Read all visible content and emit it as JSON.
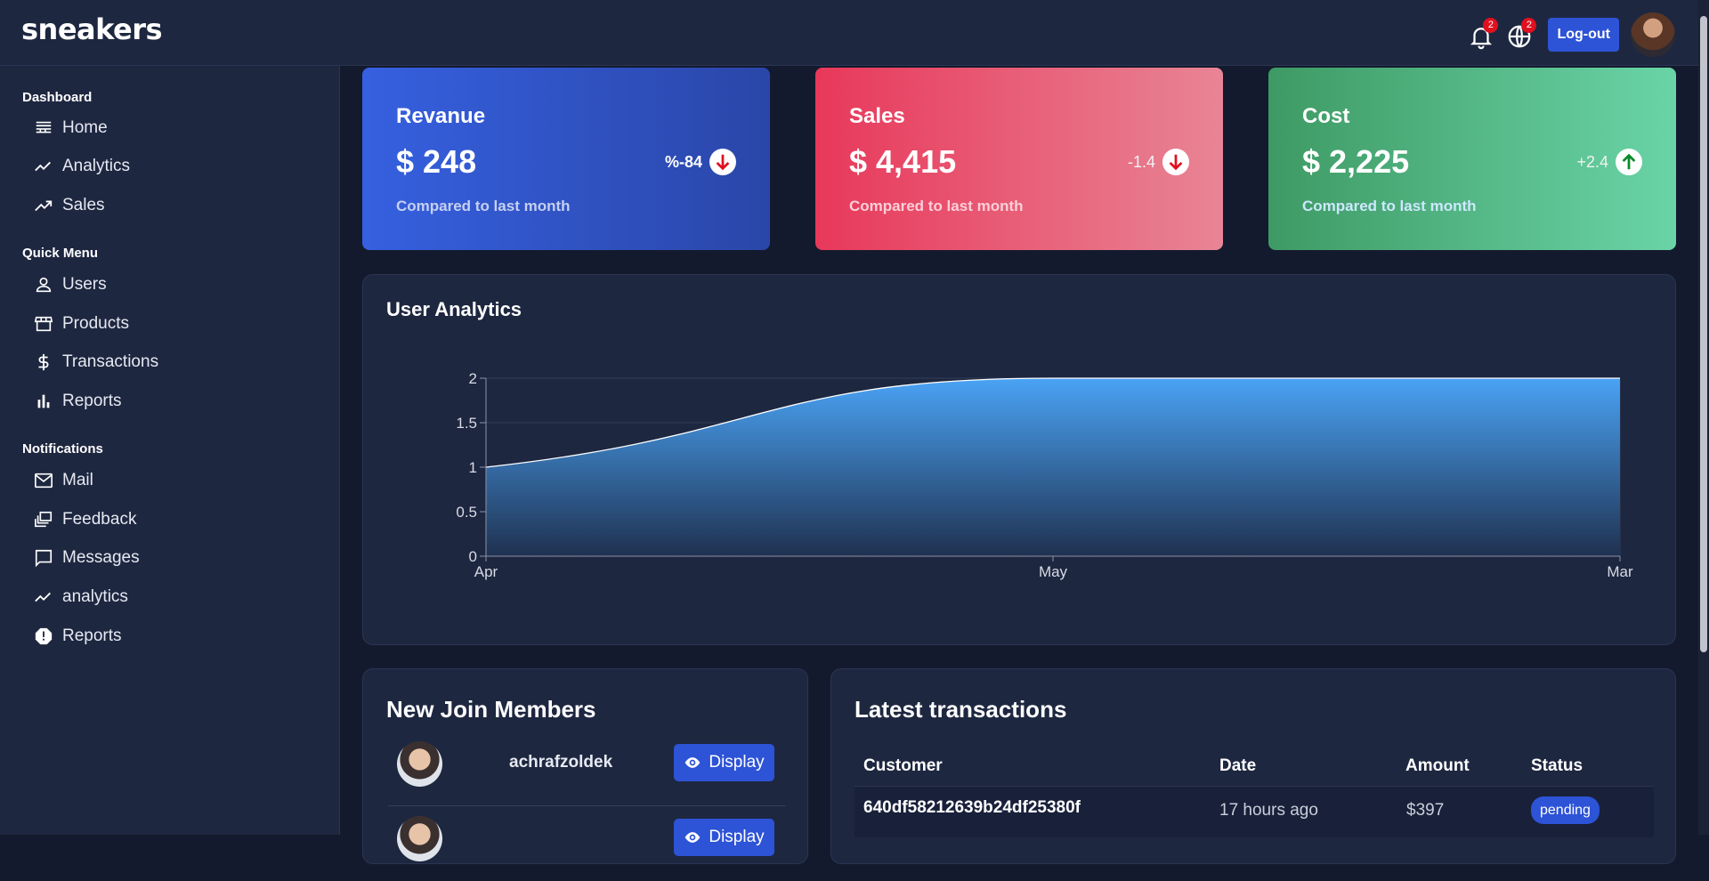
{
  "app": {
    "logo": "sneakers"
  },
  "topbar": {
    "notifications_badge": "2",
    "language_badge": "2",
    "logout_label": "Log-out"
  },
  "sidebar": {
    "sections": [
      {
        "title": "Dashboard",
        "items": [
          {
            "label": "Home",
            "icon": "home-icon"
          },
          {
            "label": "Analytics",
            "icon": "timeline-icon"
          },
          {
            "label": "Sales",
            "icon": "trending-up-icon"
          }
        ]
      },
      {
        "title": "Quick Menu",
        "items": [
          {
            "label": "Users",
            "icon": "user-icon"
          },
          {
            "label": "Products",
            "icon": "storefront-icon"
          },
          {
            "label": "Transactions",
            "icon": "dollar-icon"
          },
          {
            "label": "Reports",
            "icon": "bar-chart-icon"
          }
        ]
      },
      {
        "title": "Notifications",
        "items": [
          {
            "label": "Mail",
            "icon": "mail-icon"
          },
          {
            "label": "Feedback",
            "icon": "dynamic-feed-icon"
          },
          {
            "label": "Messages",
            "icon": "chat-icon"
          },
          {
            "label": "analytics",
            "icon": "timeline-icon"
          },
          {
            "label": "Reports",
            "icon": "report-icon"
          }
        ]
      }
    ]
  },
  "cards": [
    {
      "title": "Revanue",
      "value": "$ 248",
      "rate": "%-84",
      "trend": "down",
      "subtitle": "Compared to last month"
    },
    {
      "title": "Sales",
      "value": "$ 4,415",
      "rate": "-1.4",
      "trend": "down",
      "subtitle": "Compared to last month"
    },
    {
      "title": "Cost",
      "value": "$ 2,225",
      "rate": "+2.4",
      "trend": "up",
      "subtitle": "Compared to last month"
    }
  ],
  "analytics": {
    "title": "User Analytics",
    "chart_data": {
      "type": "area",
      "categories": [
        "Apr",
        "May",
        "Mar"
      ],
      "series": [
        {
          "values": [
            1,
            2,
            2
          ]
        }
      ],
      "ylim": [
        0,
        2
      ],
      "yticks": [
        "0",
        "0.5",
        "1",
        "1.5",
        "2"
      ],
      "grid": true,
      "colors": {
        "fill_top": "#4aa3f5",
        "fill_bottom": "#1f3150",
        "line": "#ffffff"
      }
    }
  },
  "members": {
    "title": "New Join Members",
    "items": [
      {
        "name": "achrafzoldek",
        "button": "Display"
      },
      {
        "name": "",
        "button": "Display"
      }
    ]
  },
  "transactions": {
    "title": "Latest transactions",
    "headers": [
      "Customer",
      "Date",
      "Amount",
      "Status"
    ],
    "rows": [
      {
        "customer": "640df58212639b24df25380f",
        "date": "17 hours ago",
        "amount": "$397",
        "status": "pending"
      }
    ]
  }
}
